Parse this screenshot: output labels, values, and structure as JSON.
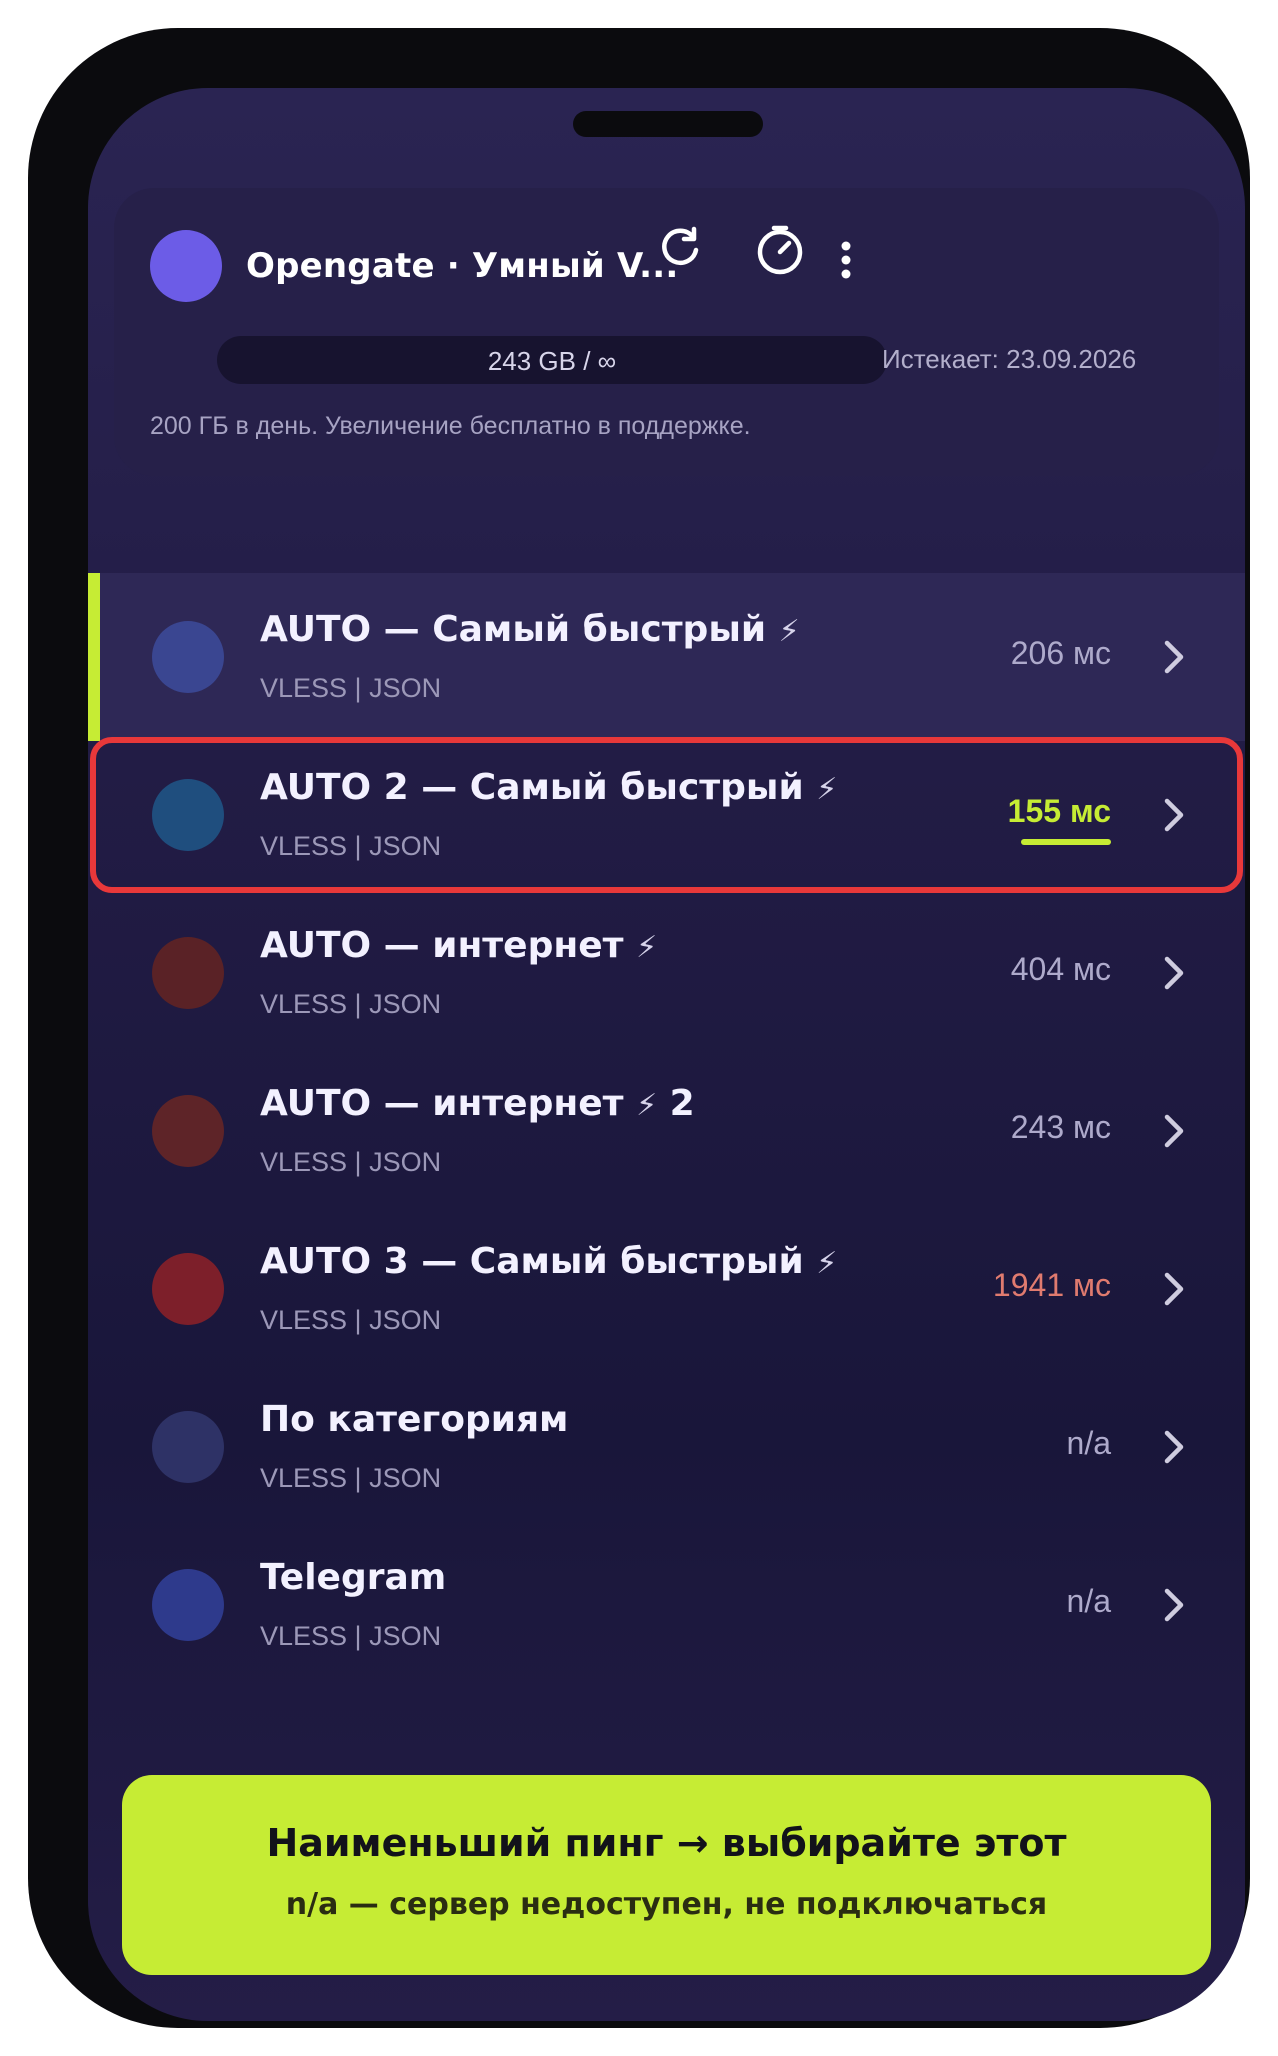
{
  "header": {
    "title": "Opengate · Умный V...",
    "usage": "243 GB / ∞",
    "expiry": "Истекает: 23.09.2026",
    "quota_note": "200 ГБ в день. Увеличение бесплатно в поддержке.",
    "avatar_color": "#6c5ce7",
    "icons": [
      "refresh-icon",
      "speedometer-icon",
      "more-vertical-icon"
    ]
  },
  "servers": [
    {
      "name": "AUTO — Самый быстрый",
      "bolt": "⚡",
      "suffix": "",
      "proto": "VLESS | JSON",
      "ping": "206 мс",
      "dot_color": "#3a4691",
      "state": "active"
    },
    {
      "name": "AUTO 2 — Самый быстрый",
      "bolt": "⚡",
      "suffix": "",
      "proto": "VLESS | JSON",
      "ping": "155 мс",
      "dot_color": "#1f4e7e",
      "state": "best"
    },
    {
      "name": "AUTO — интернет",
      "bolt": "⚡",
      "suffix": "",
      "proto": "VLESS | JSON",
      "ping": "404 мс",
      "dot_color": "#5a2226",
      "state": "normal"
    },
    {
      "name": "AUTO — интернет",
      "bolt": "⚡",
      "suffix": " 2",
      "proto": "VLESS | JSON",
      "ping": "243 мс",
      "dot_color": "#5e2428",
      "state": "normal"
    },
    {
      "name": "AUTO 3 — Самый быстрый",
      "bolt": "⚡",
      "suffix": "",
      "proto": "VLESS | JSON",
      "ping": "1941 мс",
      "dot_color": "#7d1f2a",
      "state": "slow"
    },
    {
      "name": "По категориям",
      "bolt": "",
      "suffix": "",
      "proto": "VLESS | JSON",
      "ping": "n/a",
      "dot_color": "#2e3266",
      "state": "normal"
    },
    {
      "name": "Telegram",
      "bolt": "",
      "suffix": "",
      "proto": "VLESS | JSON",
      "ping": "n/a",
      "dot_color": "#2e3a8c",
      "state": "normal"
    }
  ],
  "banner": {
    "title": "Наименьший пинг → выбирайте этот",
    "subtitle": "n/a — сервер недоступен, не подключаться"
  },
  "colors": {
    "accent": "#c6ec34",
    "highlight": "#e8383a",
    "slow": "#e07b6f"
  }
}
